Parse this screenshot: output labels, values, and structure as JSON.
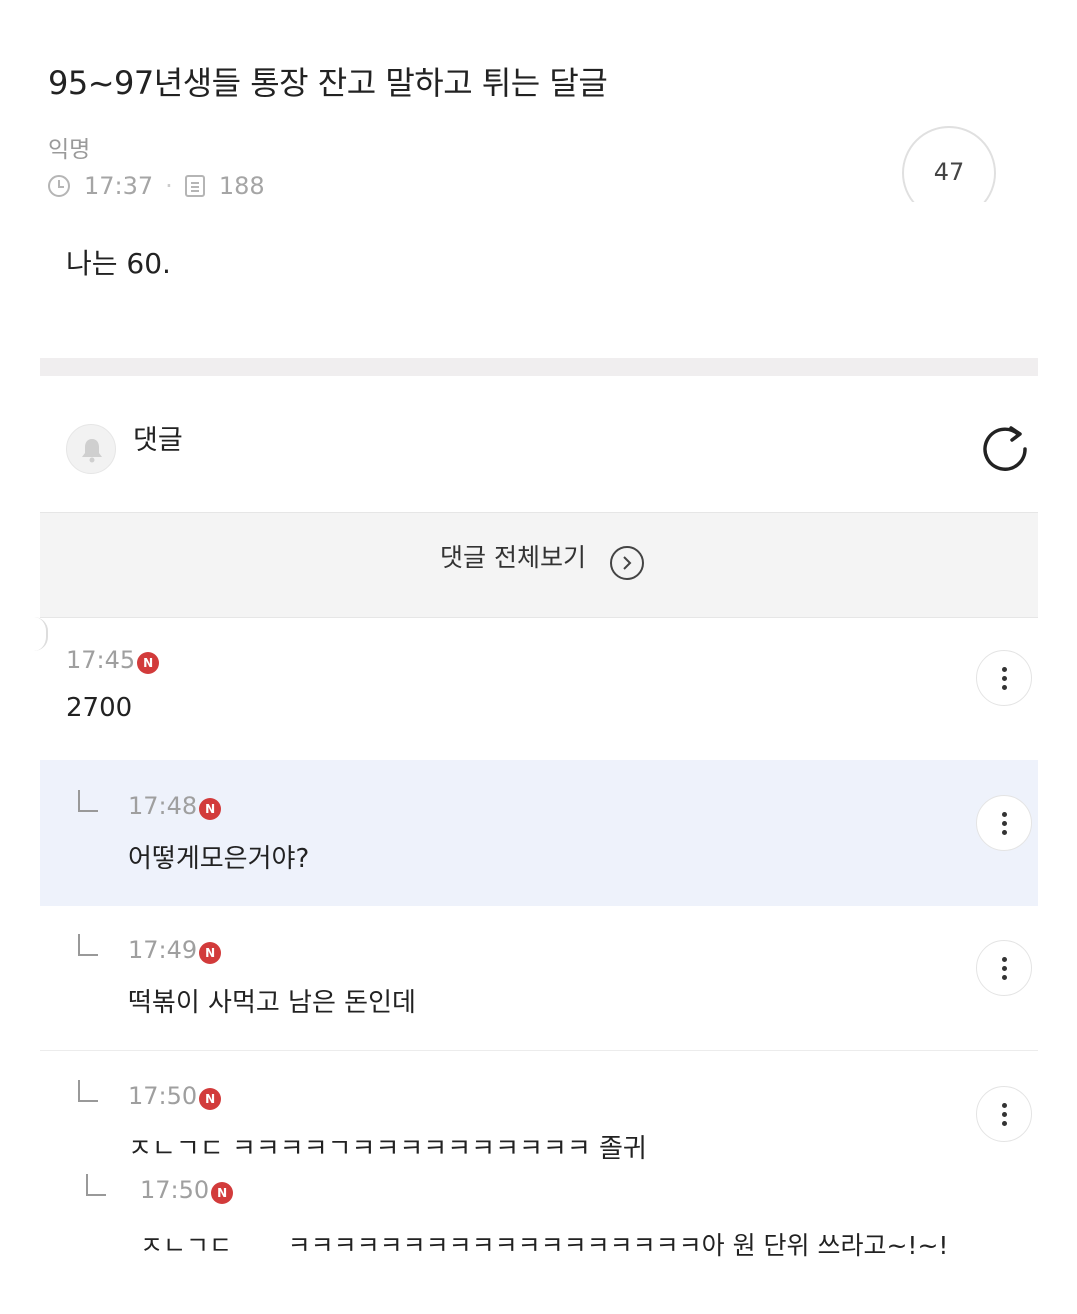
{
  "post": {
    "title": "95~97년생들 통장 잔고 말하고 튀는 달글",
    "author": "익명",
    "time": "17:37",
    "views": "188",
    "likes": "47",
    "body": "나는 60."
  },
  "comments_header": {
    "label": "댓글",
    "view_all": "댓글 전체보기"
  },
  "badge_letter": "N",
  "comments": [
    {
      "time": "17:45",
      "text": "2700"
    },
    {
      "time": "17:48",
      "text": "어떻게모은거야?"
    },
    {
      "time": "17:49",
      "text": "떡볶이 사먹고 남은 돈인데"
    },
    {
      "time": "17:50",
      "text": "ㅈㄴㄱㄷ ㅋㅋㅋㅋㄱㅋㅋㅋㅋㅋㅋㅋㅋㅋㅋ 졸귀"
    },
    {
      "time": "17:50",
      "text": "ㅈㄴㄱㄷ       ㅋㅋㅋㅋㅋㅋㅋㅋㅋㅋㅋㅋㅋㅋㅋㅋㅋㅋ아 원 단위 쓰라고~!~!"
    }
  ],
  "colors": {
    "badge": "#d23b3b",
    "highlight": "#eef2fb",
    "divider": "#f0eeef"
  }
}
